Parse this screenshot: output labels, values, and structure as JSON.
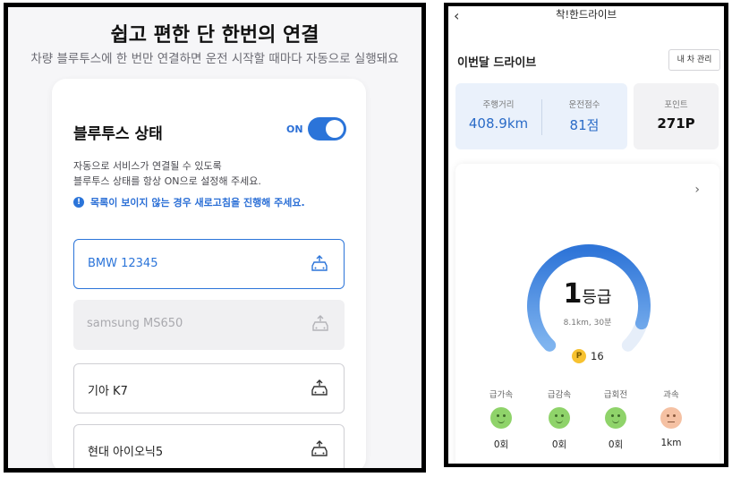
{
  "left": {
    "title": "쉽고 편한 단 한번의 연결",
    "subtitle": "차량 블루투스에 한 번만 연결하면 운전 시작할 때마다 자동으로 실행돼요",
    "bluetooth": {
      "title": "블루투스 상태",
      "toggle_label": "ON",
      "toggle_on": true,
      "desc_line1": "자동으로 서비스가 연결될 수 있도록",
      "desc_line2": "블루투스 상태를 항상 ON으로 설정해 주세요.",
      "notice": "목록이 보이지 않는 경우 새로고침을 진행해 주세요."
    },
    "devices": [
      {
        "name": "BMW 12345",
        "state": "selected"
      },
      {
        "name": "samsung MS650",
        "state": "disabled"
      },
      {
        "name": "기아 K7",
        "state": "normal"
      },
      {
        "name": "현대 아이오닉5",
        "state": "normal"
      }
    ]
  },
  "right": {
    "header_title": "착!한드라이브",
    "back_glyph": "‹",
    "month_title": "이번달 드라이브",
    "car_manage_label": "내 차 관리",
    "stats": [
      {
        "label": "주행거리",
        "value": "408.9km"
      },
      {
        "label": "운전점수",
        "value": "81점"
      }
    ],
    "points": {
      "label": "포인트",
      "value": "271P"
    },
    "grade": {
      "number": "1",
      "unit": "등급",
      "sub": "8.1km, 30분",
      "gauge_fraction": 0.9,
      "coin_label": "P",
      "coin_value": "16"
    },
    "chevron_glyph": "›",
    "metrics": [
      {
        "label": "급가속",
        "value": "0회",
        "mood": "good"
      },
      {
        "label": "급감속",
        "value": "0회",
        "mood": "good"
      },
      {
        "label": "급회전",
        "value": "0회",
        "mood": "good"
      },
      {
        "label": "과속",
        "value": "1km",
        "mood": "meh"
      }
    ]
  },
  "colors": {
    "accent": "#2b74d9",
    "good": "#8fd36a",
    "warn": "#f5c1a3"
  }
}
